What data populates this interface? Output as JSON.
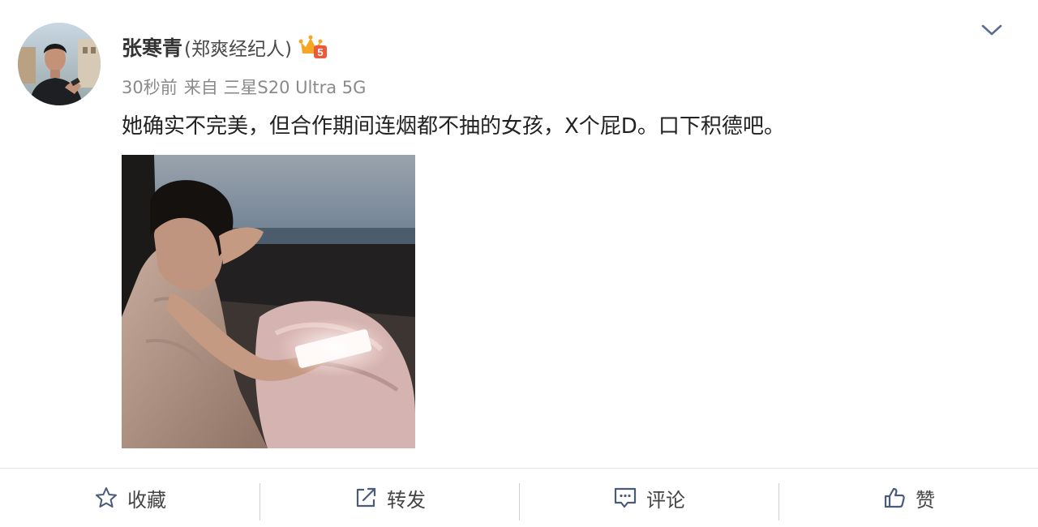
{
  "post": {
    "author": {
      "name": "张寒青",
      "tag": "(郑爽经纪人)",
      "vip_level": "5"
    },
    "meta": {
      "time": "30秒前",
      "source": "来自 三星S20 Ultra 5G"
    },
    "text": "她确实不完美，但合作期间连烟都不抽的女孩，X个屁D。口下积德吧。",
    "image": {
      "icon": "photo-girl-in-car-with-phone"
    }
  },
  "actions": {
    "favorite": {
      "label": "收藏",
      "icon": "star-icon"
    },
    "repost": {
      "label": "转发",
      "icon": "share-icon"
    },
    "comment": {
      "label": "评论",
      "icon": "comment-icon"
    },
    "like": {
      "label": "赞",
      "icon": "thumbs-up-icon"
    }
  },
  "colors": {
    "accent": "#eb7350",
    "badge_orange": "#f5a623",
    "muted_text": "#8a8a8a",
    "chevron": "#5c6f8f"
  }
}
